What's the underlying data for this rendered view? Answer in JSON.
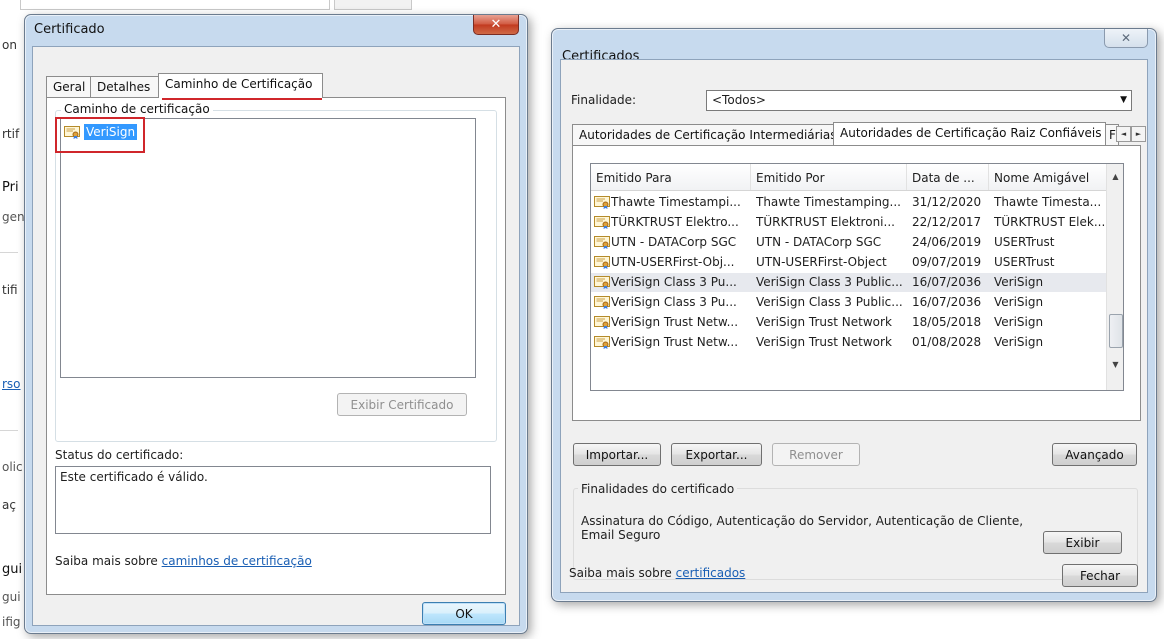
{
  "background": {
    "fragments": [
      "on",
      "rtif",
      "Pri",
      "gen",
      "tifi",
      "rso",
      "olic",
      "aç",
      "gui",
      "gui",
      "ifig"
    ]
  },
  "left_dialog": {
    "title": "Certificado",
    "close_glyph": "✕",
    "tabs": [
      "Geral",
      "Detalhes",
      "Caminho de Certificação"
    ],
    "path_group_label": "Caminho de certificação",
    "tree_item": "VeriSign",
    "view_cert_button": "Exibir Certificado",
    "status_label": "Status do certificado:",
    "status_text": "Este certificado é válido.",
    "learn_more_prefix": "Saiba mais sobre ",
    "learn_more_link": "caminhos de certificação",
    "ok_button": "OK"
  },
  "right_dialog": {
    "title": "Certificados",
    "close_glyph": "✕",
    "purpose_label": "Finalidade:",
    "purpose_value": "<Todos>",
    "tabs": [
      "Autoridades de Certificação Intermediárias",
      "Autoridades de Certificação Raiz Confiáveis",
      "F"
    ],
    "tab_scroll_left": "◄",
    "tab_scroll_right": "►",
    "columns": [
      "Emitido Para",
      "Emitido Por",
      "Data de ...",
      "Nome Amigável"
    ],
    "rows": [
      {
        "issued_to": "Thawte Timestampi...",
        "issued_by": "Thawte Timestamping...",
        "date": "31/12/2020",
        "friendly": "Thawte Timesta..."
      },
      {
        "issued_to": "TÜRKTRUST Elektro...",
        "issued_by": "TÜRKTRUST Elektroni...",
        "date": "22/12/2017",
        "friendly": "TÜRKTRUST Elek..."
      },
      {
        "issued_to": "UTN - DATACorp SGC",
        "issued_by": "UTN - DATACorp SGC",
        "date": "24/06/2019",
        "friendly": "USERTrust"
      },
      {
        "issued_to": "UTN-USERFirst-Obj...",
        "issued_by": "UTN-USERFirst-Object",
        "date": "09/07/2019",
        "friendly": "USERTrust"
      },
      {
        "issued_to": "VeriSign Class 3 Pu...",
        "issued_by": "VeriSign Class 3 Public...",
        "date": "16/07/2036",
        "friendly": "VeriSign"
      },
      {
        "issued_to": "VeriSign Class 3 Pu...",
        "issued_by": "VeriSign Class 3 Public...",
        "date": "16/07/2036",
        "friendly": "VeriSign"
      },
      {
        "issued_to": "VeriSign Trust Netw...",
        "issued_by": "VeriSign Trust Network",
        "date": "18/05/2018",
        "friendly": "VeriSign"
      },
      {
        "issued_to": "VeriSign Trust Netw...",
        "issued_by": "VeriSign Trust Network",
        "date": "01/08/2028",
        "friendly": "VeriSign"
      }
    ],
    "selected_row_index": 4,
    "import_button": "Importar...",
    "export_button": "Exportar...",
    "remove_button": "Remover",
    "advanced_button": "Avançado",
    "purposes_group_label": "Finalidades do certificado",
    "purposes_text_line1": "Assinatura do Código, Autenticação do Servidor, Autenticação de Cliente,",
    "purposes_text_line2": "Email Seguro",
    "view_button": "Exibir",
    "learn_more_prefix": "Saiba mais sobre ",
    "learn_more_link": "certificados",
    "close_button": "Fechar"
  },
  "colors": {
    "selection": "#3399ff",
    "annotation_red": "#d0262b",
    "link": "#1a5fb4"
  }
}
